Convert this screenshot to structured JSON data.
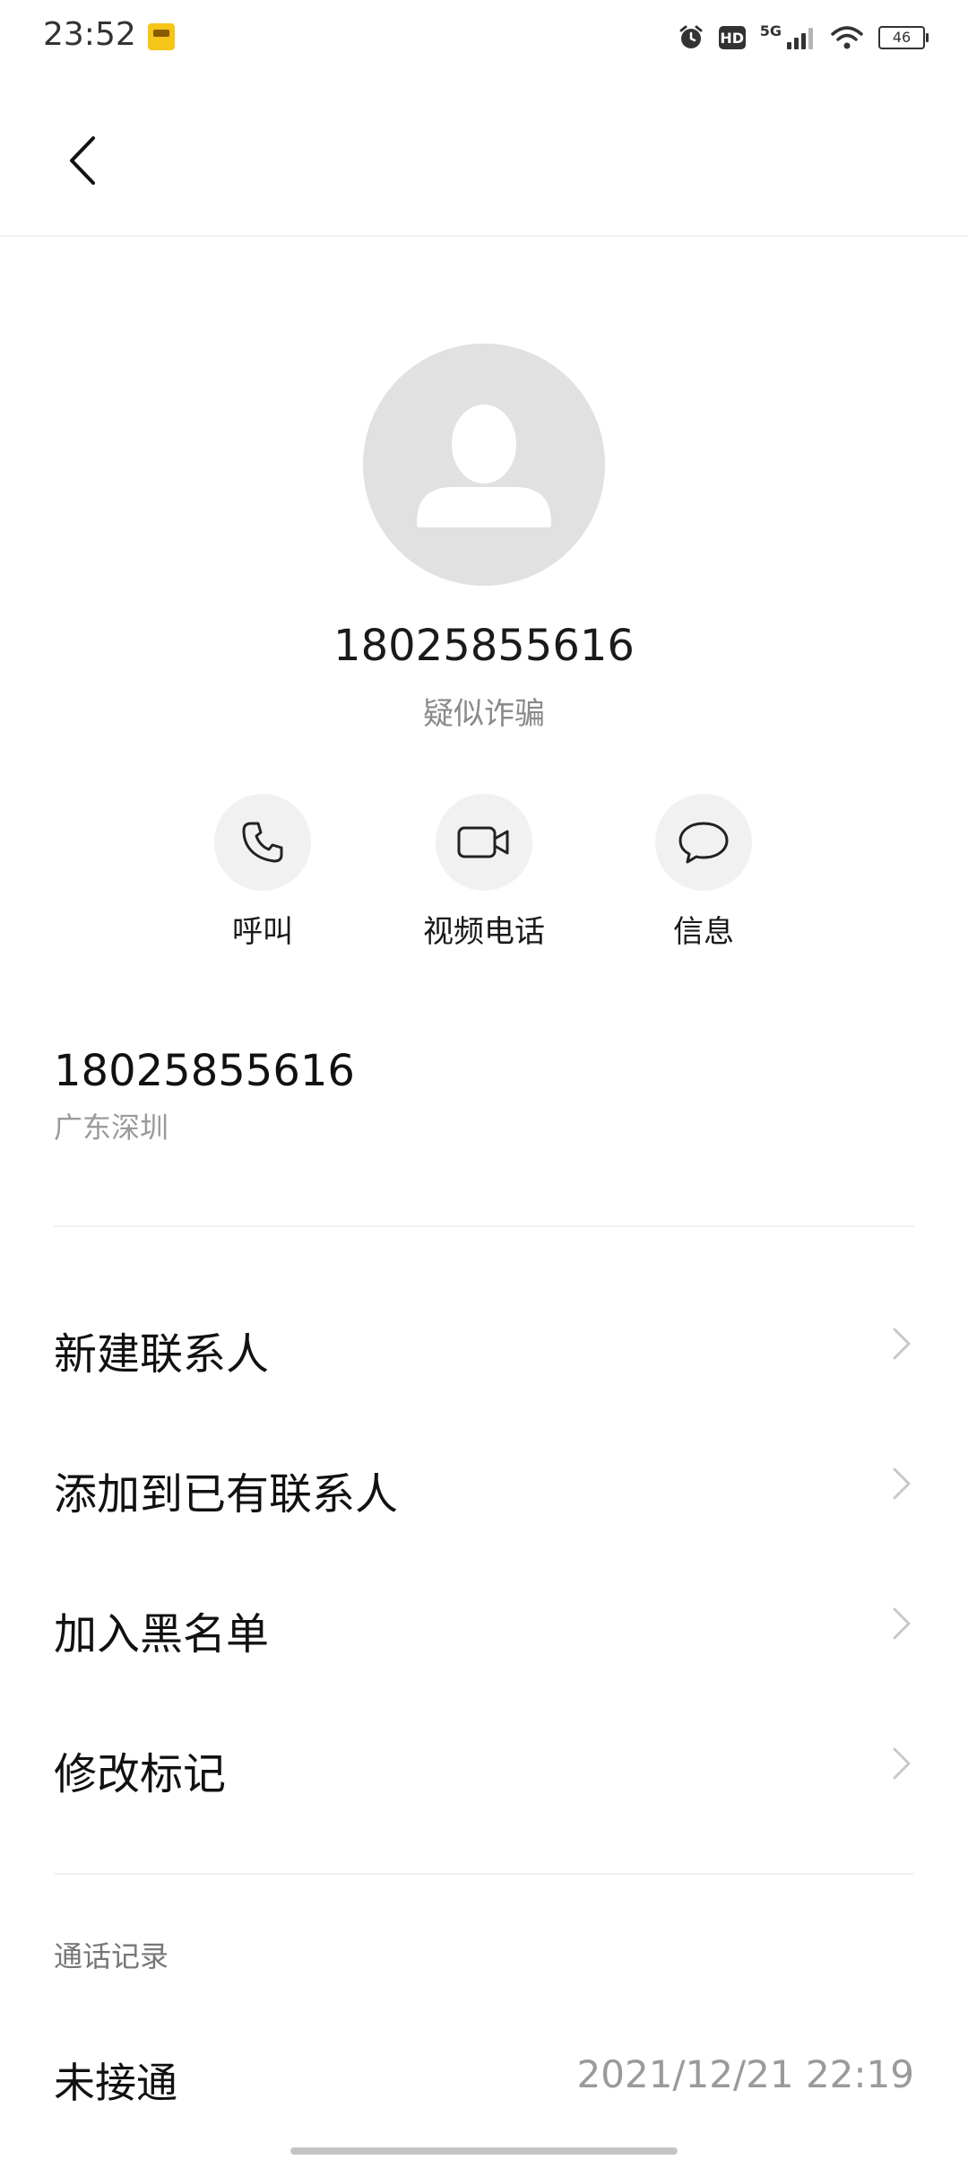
{
  "status_bar": {
    "time": "23:52",
    "hd": "HD",
    "network": "5G",
    "battery": "46"
  },
  "contact": {
    "number": "18025855616",
    "tag": "疑似诈骗"
  },
  "actions": [
    {
      "label": "呼叫",
      "icon": "phone-icon"
    },
    {
      "label": "视频电话",
      "icon": "video-camera-icon"
    },
    {
      "label": "信息",
      "icon": "message-bubble-icon"
    }
  ],
  "number_section": {
    "number": "18025855616",
    "region": "广东深圳"
  },
  "menu": [
    {
      "label": "新建联系人"
    },
    {
      "label": "添加到已有联系人"
    },
    {
      "label": "加入黑名单"
    },
    {
      "label": "修改标记"
    }
  ],
  "call_log": {
    "title": "通话记录",
    "entries": [
      {
        "status": "未接通",
        "time": "2021/12/21 22:19"
      }
    ]
  },
  "colors": {
    "background": "#ffffff",
    "avatar_bg": "#e1e1e1",
    "button_bg": "#f1f1f1",
    "secondary_text": "#9a9a9a"
  }
}
